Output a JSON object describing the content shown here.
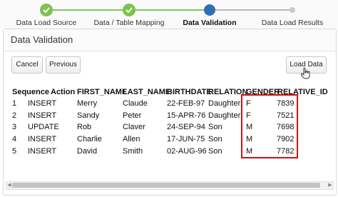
{
  "wizard": {
    "steps": [
      {
        "label": "Data Load Source",
        "state": "done"
      },
      {
        "label": "Data / Table Mapping",
        "state": "done"
      },
      {
        "label": "Data Validation",
        "state": "current"
      },
      {
        "label": "Data Load Results",
        "state": "todo"
      }
    ]
  },
  "region": {
    "title": "Data Validation"
  },
  "buttons": {
    "cancel": "Cancel",
    "previous": "Previous",
    "load_data": "Load Data"
  },
  "table": {
    "columns": [
      "Sequence",
      "Action",
      "FIRST_NAME",
      "LAST_NAME",
      "BIRTHDATE",
      "RELATION",
      "GENDER",
      "RELATIVE_ID"
    ],
    "rows": [
      [
        "1",
        "INSERT",
        "Merry",
        "Claude",
        "22-FEB-97",
        "Daughter",
        "F",
        "7839"
      ],
      [
        "2",
        "INSERT",
        "Sandy",
        "Peter",
        "15-APR-76",
        "Daughter",
        "F",
        "7521"
      ],
      [
        "3",
        "UPDATE",
        "Rob",
        "Claver",
        "24-SEP-94",
        "Son",
        "M",
        "7698"
      ],
      [
        "4",
        "INSERT",
        "Charlie",
        "Allen",
        "17-JUN-75",
        "Son",
        "M",
        "7902"
      ],
      [
        "5",
        "INSERT",
        "David",
        "Smith",
        "02-AUG-96",
        "Son",
        "M",
        "7782"
      ]
    ]
  },
  "colors": {
    "done": "#7ec24e",
    "current": "#2f6fb5",
    "highlight_border": "#d41111"
  }
}
